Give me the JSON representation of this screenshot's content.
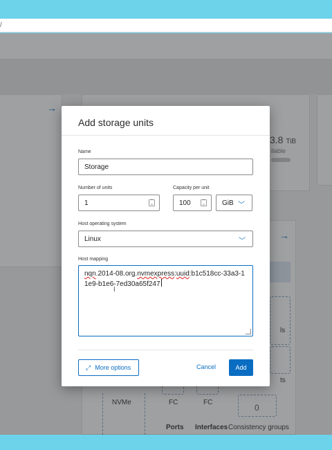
{
  "browser": {
    "url_fragment": "/"
  },
  "background": {
    "capacity_value": "3.8",
    "capacity_unit": "TiB",
    "capacity_sub": "ilable",
    "card_fragment_1": "ls",
    "card_fragment_2": "ts",
    "connectors": [
      "NVMe",
      "FC",
      "FC"
    ],
    "consistency_count": "0",
    "footer_labels": [
      "Ports",
      "Interfaces",
      "Consistency groups"
    ]
  },
  "dialog": {
    "title": "Add storage units",
    "name_label": "Name",
    "name_value": "Storage",
    "units_label": "Number of units",
    "units_value": "1",
    "capacity_label": "Capacity per unit",
    "capacity_value": "100",
    "capacity_unit": "GiB",
    "os_label": "Host operating system",
    "os_value": "Linux",
    "mapping_label": "Host mapping",
    "mapping_part1": "nqn",
    "mapping_part2": ".2014-08.org.",
    "mapping_part3": "nvmexpress",
    "mapping_part4": ":",
    "mapping_part5": "uuid",
    "mapping_part6": ":b1c518cc-33a3-11e9-b1e6-7ed30a65f247",
    "more_options": "More options",
    "cancel": "Cancel",
    "add": "Add"
  },
  "icons": {
    "expand": "expand-arrows-icon",
    "chevron": "chevron-down-icon",
    "spinner": "spin-buttons-icon",
    "arrow": "arrow-right-icon"
  },
  "colors": {
    "accent": "#0b6dc2",
    "top_band": "#6cd3ea",
    "overlay": "rgba(40,44,48,0.45)"
  }
}
